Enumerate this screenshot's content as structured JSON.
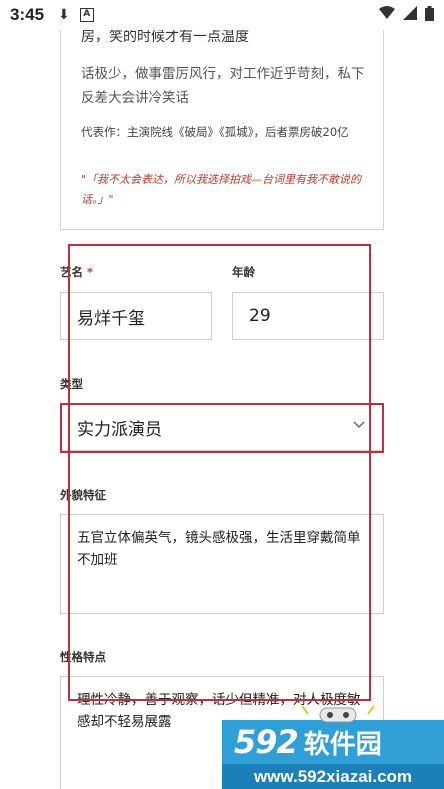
{
  "status": {
    "time": "3:45",
    "download_icon": "download-icon",
    "app_icon": "A"
  },
  "intro": {
    "line1": "房，笑的时候才有一点温度",
    "line2": "话极少，做事雷厉风行，对工作近乎苛刻，私下反差大会讲冷笑话",
    "works": "代表作：主演院线《破局》《孤城》，后者票房破20亿",
    "quote": "\"「我不太会表达，所以我选择拍戏—台词里有我不敢说的话。」\""
  },
  "form": {
    "stage_name": {
      "label": "艺名",
      "required_mark": "*",
      "value": "易烊千玺"
    },
    "age": {
      "label": "年龄",
      "value": "29"
    },
    "type": {
      "label": "类型",
      "value": "实力派演员"
    },
    "appearance": {
      "label": "外貌特征",
      "value": "五官立体偏英气，镜头感极强，生活里穿戴简单不加班"
    },
    "personality": {
      "label": "性格特点",
      "value": "理性冷静，善于观察，话少但精准，对人极度敏感却不轻易展露"
    }
  },
  "watermark": {
    "brand_num": "592",
    "brand_cn": "软件园",
    "url": "www.592xiazai.com"
  },
  "colors": {
    "accent_red": "#c0303a",
    "watermark_blue": "#2f9fd6"
  }
}
